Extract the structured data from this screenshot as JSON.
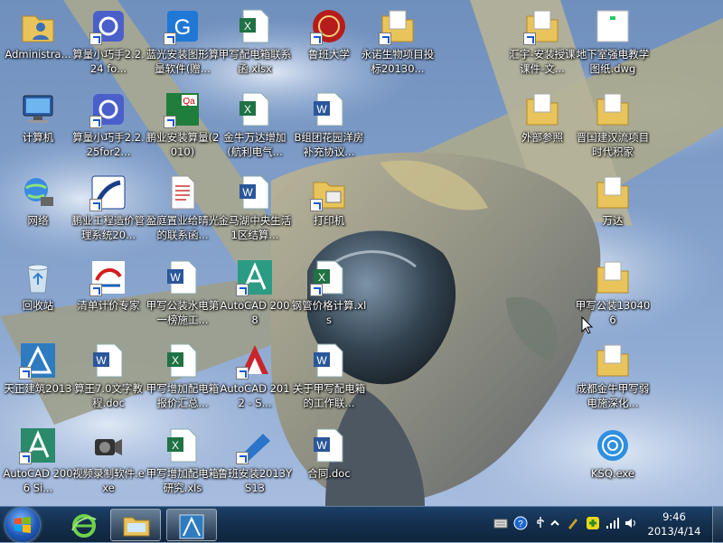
{
  "desktop": {
    "icons": [
      {
        "label": "Administra...",
        "icon": "user-folder-icon"
      },
      {
        "label": "算量小巧手2.2.24 fo...",
        "icon": "calculator-app-icon"
      },
      {
        "label": "蓝光安装图形算量软件(赠...",
        "icon": "bluelight-app-icon"
      },
      {
        "label": "甲写配电箱联系函.xlsx",
        "icon": "excel-file-icon"
      },
      {
        "label": "鲁班大学",
        "icon": "luban-university-icon"
      },
      {
        "label": "永诺生物项目投标20130...",
        "icon": "folder-icon"
      },
      {
        "label": "计算机",
        "icon": "computer-icon"
      },
      {
        "label": "算量小巧手2.2.25for2...",
        "icon": "calculator-app-icon"
      },
      {
        "label": "鹏业安装算量(2010)",
        "icon": "pengye-app-icon"
      },
      {
        "label": "金牛万达增加(航利电气...",
        "icon": "excel-file-icon"
      },
      {
        "label": "B组团花园洋房补充协议...",
        "icon": "word-file-icon"
      },
      {
        "label": "网络",
        "icon": "network-icon"
      },
      {
        "label": "鹏业工程造价管理系统20...",
        "icon": "pengye-cost-app-icon"
      },
      {
        "label": "盈庭置业给晴光的联系函...",
        "icon": "text-document-icon"
      },
      {
        "label": "金马湖中央生活1区结算...",
        "icon": "word-file-icon"
      },
      {
        "label": "打印机",
        "icon": "printer-folder-icon"
      },
      {
        "label": "回收站",
        "icon": "recycle-bin-icon"
      },
      {
        "label": "清单计价专家",
        "icon": "qingdan-app-icon"
      },
      {
        "label": "甲写公装水电第一榜施工...",
        "icon": "word-file-icon"
      },
      {
        "label": "AutoCAD 2008",
        "icon": "autocad-2008-icon"
      },
      {
        "label": "钢管价格计算.xls",
        "icon": "excel-file-icon"
      },
      {
        "label": "天正建筑2013",
        "icon": "tangent-app-icon"
      },
      {
        "label": "算王7.0文字教程.doc",
        "icon": "word-file-icon"
      },
      {
        "label": "甲写增加配电箱报价汇总...",
        "icon": "excel-file-icon"
      },
      {
        "label": "AutoCAD 2012 - S...",
        "icon": "autocad-2012-icon"
      },
      {
        "label": "关于甲写配电箱的工作联...",
        "icon": "word-file-icon"
      },
      {
        "label": "AutoCAD 2006 Si...",
        "icon": "autocad-2006-icon"
      },
      {
        "label": "视频录制软件.exe",
        "icon": "video-recorder-icon"
      },
      {
        "label": "甲写增加配电箱研究.xls",
        "icon": "excel-file-icon"
      },
      {
        "label": "鲁班安装2013YS13",
        "icon": "luban-install-icon"
      },
      {
        "label": "合同.doc",
        "icon": "word-file-icon"
      },
      {
        "label": "汇宇-安装授课课件-文...",
        "icon": "folder-icon"
      },
      {
        "label": "地下室强电教学图纸.dwg",
        "icon": "dwg-file-icon"
      },
      {
        "label": "外部参照",
        "icon": "folder-icon"
      },
      {
        "label": "晋国建汉流项目时代积家",
        "icon": "folder-icon"
      },
      {
        "label": "万达",
        "icon": "folder-icon"
      },
      {
        "label": "甲写公装130406",
        "icon": "folder-icon"
      },
      {
        "label": "成都金牛甲写弱电施深化...",
        "icon": "folder-icon"
      },
      {
        "label": "KSQ.exe",
        "icon": "ksq-app-icon"
      }
    ]
  },
  "taskbar": {
    "start_icon": "windows-logo-icon",
    "pinned": [
      {
        "name": "internet-explorer",
        "icon": "ie-icon"
      },
      {
        "name": "windows-explorer",
        "icon": "folder-icon"
      },
      {
        "name": "tangent-architecture",
        "icon": "tangent-app-icon"
      }
    ],
    "tray_icons": [
      "keyboard-icon",
      "help-icon",
      "usb-icon",
      "chevron-up-icon",
      "pen-icon",
      "green-plus-icon",
      "network-signal-icon",
      "volume-icon"
    ],
    "clock_time": "9:46",
    "clock_date": "2013/4/14"
  },
  "colors": {
    "taskbar": "#14304f",
    "sky": "#7e9cc4",
    "label_text": "#ffffff"
  }
}
